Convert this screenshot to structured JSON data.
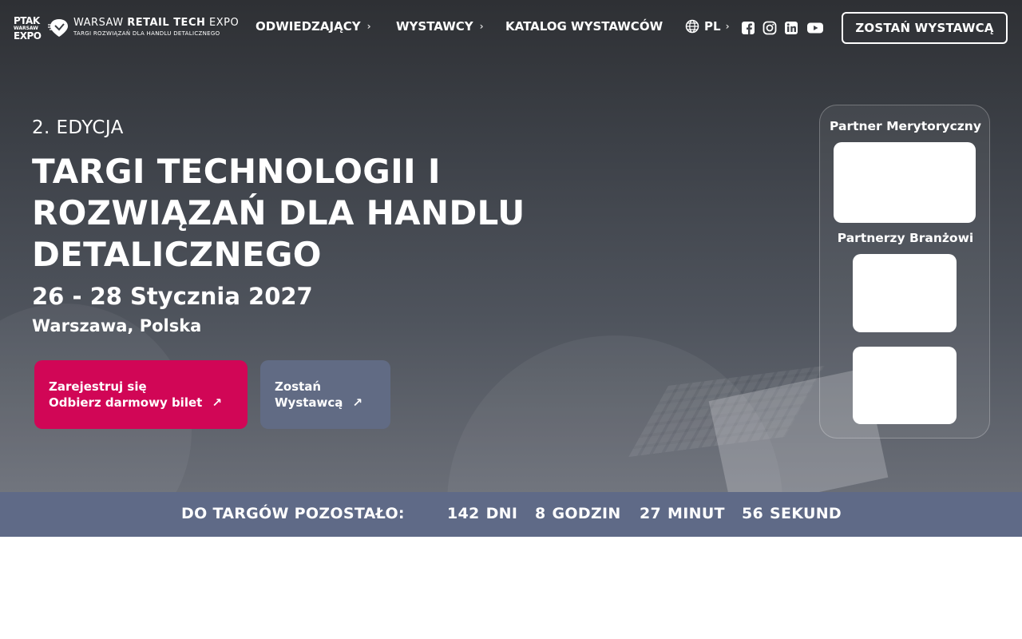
{
  "logo": {
    "ptak_line1": "PTAK",
    "ptak_line2": "WARSAW",
    "ptak_line3": "EXPO",
    "brand_thin": "WARSAW ",
    "brand_bold": "RETAIL TECH",
    "brand_end": " EXPO",
    "tagline": "TARGI ROZWIĄZAŃ DLA HANDLU DETALICZNEGO"
  },
  "nav": {
    "visitors": "ODWIEDZAJĄCY",
    "exhibitors": "WYSTAWCY",
    "catalog": "KATALOG WYSTAWCÓW",
    "language": "PL",
    "cta": "ZOSTAŃ WYSTAWCĄ"
  },
  "social": [
    "facebook-icon",
    "instagram-icon",
    "linkedin-icon",
    "youtube-icon"
  ],
  "hero": {
    "edition": "2. EDYCJA",
    "headline_line1": "TARGI TECHNOLOGII I",
    "headline_line2": "ROZWIĄZAŃ DLA HANDLU",
    "headline_line3": "DETALICZNEGO",
    "dates": "26 - 28 Stycznia 2027",
    "place": "Warszawa, Polska",
    "register_line1": "Zarejestruj się",
    "register_line2": "Odbierz darmowy bilet",
    "exhibitor_line1": "Zostań",
    "exhibitor_line2": "Wystawcą",
    "arrow": "↗"
  },
  "partners": {
    "merit_title": "Partner Merytoryczny",
    "industry_title": "Partnerzy Branżowi"
  },
  "countdown": {
    "label": "DO TARGÓW POZOSTAŁO:",
    "days_value": "142",
    "days_unit": "DNI",
    "hours_value": "8",
    "hours_unit": "GODZIN",
    "minutes_value": "27",
    "minutes_unit": "MINUT",
    "seconds_value": "56",
    "seconds_unit": "SEKUND"
  },
  "colors": {
    "accent_pink": "#d10656",
    "secondary_slate": "#616b84",
    "countdown_bar": "#5f6a87"
  }
}
